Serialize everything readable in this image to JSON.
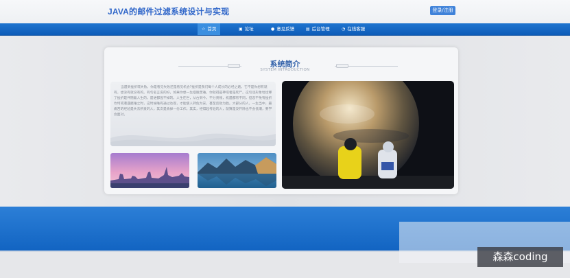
{
  "header": {
    "site_title": "JAVA的邮件过滤系统设计与实现",
    "login_label": "登录/注册"
  },
  "nav": {
    "items": [
      {
        "icon": "home-icon",
        "label": "首页"
      },
      {
        "icon": "forum-icon",
        "label": "论坛"
      },
      {
        "icon": "feedback-icon",
        "label": "意见反馈"
      },
      {
        "icon": "admin-icon",
        "label": "后台管理"
      },
      {
        "icon": "service-icon",
        "label": "在线客服"
      }
    ],
    "active_index": 0
  },
  "section": {
    "title": "系统简介",
    "subtitle": "SYSTEM INTRODUCTION"
  },
  "intro": {
    "text": "当遇到挫折或失败，你是看见失败还是看见机会?挫折是我们每个人成长的必经之路，它不是你想有就有，想没有就没有的。有句名言说的好，如果你想一生摆脱苦难，你就得是神或者是死尸。这句话形象地诠释了挫折是伴随着人生的，是谁都逃不掉的。人生在世，从古到今，不分贵贱，机遇都有不同，但忽不免有挫折坎坷或遭遇磨难之时，这时候唯有通过达观，才能使人转危为安，甚至反败为胜。大部分的人，一生当中，最痛苦的经验是失去所爱的人，其次是丢掉一份工作。其实，经得起考验的人，就算是没开除也不会低潮，要学会面对。"
  },
  "colors": {
    "brand_blue": "#1f74cf",
    "title_blue": "#2f66c9",
    "footer_blue": "#1a6cc8"
  },
  "watermark": {
    "text": "森森coding"
  }
}
